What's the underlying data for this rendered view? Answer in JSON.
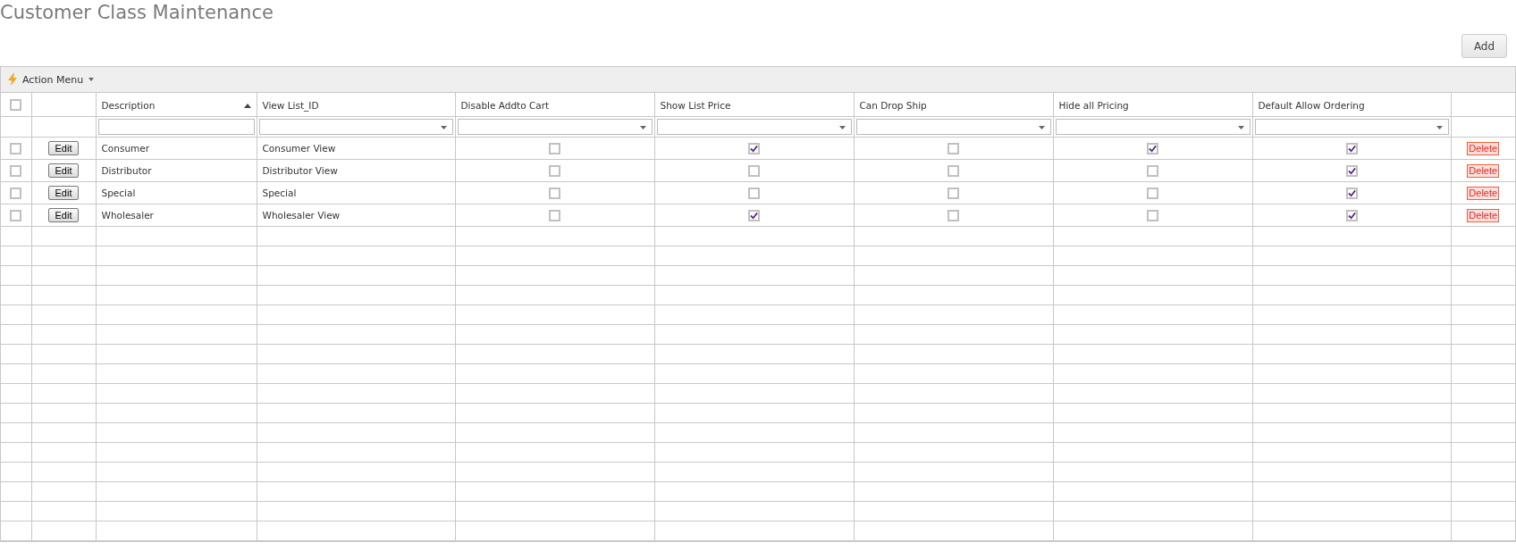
{
  "page_title": "Customer Class Maintenance",
  "add_button": "Add",
  "action_menu": {
    "label": "Action Menu"
  },
  "table": {
    "select_all_checked": false,
    "columns": [
      {
        "label": "Description",
        "sorted": true,
        "kind": "text"
      },
      {
        "label": "View List_ID",
        "sorted": false,
        "kind": "select"
      },
      {
        "label": "Disable Addto Cart",
        "sorted": false,
        "kind": "select"
      },
      {
        "label": "Show List Price",
        "sorted": false,
        "kind": "select"
      },
      {
        "label": "Can Drop Ship",
        "sorted": false,
        "kind": "select"
      },
      {
        "label": "Hide all Pricing",
        "sorted": false,
        "kind": "select"
      },
      {
        "label": "Default Allow Ordering",
        "sorted": false,
        "kind": "select"
      }
    ],
    "rows": [
      {
        "selected": false,
        "edit": "Edit",
        "description": "Consumer",
        "view_list_id": "Consumer View",
        "flags": [
          false,
          true,
          false,
          true,
          true
        ],
        "delete": "Delete"
      },
      {
        "selected": false,
        "edit": "Edit",
        "description": "Distributor",
        "view_list_id": "Distributor View",
        "flags": [
          false,
          false,
          false,
          false,
          true
        ],
        "delete": "Delete"
      },
      {
        "selected": false,
        "edit": "Edit",
        "description": "Special",
        "view_list_id": "Special",
        "flags": [
          false,
          false,
          false,
          false,
          true
        ],
        "delete": "Delete"
      },
      {
        "selected": false,
        "edit": "Edit",
        "description": "Wholesaler",
        "view_list_id": "Wholesaler View",
        "flags": [
          false,
          true,
          false,
          false,
          true
        ],
        "delete": "Delete"
      }
    ]
  }
}
